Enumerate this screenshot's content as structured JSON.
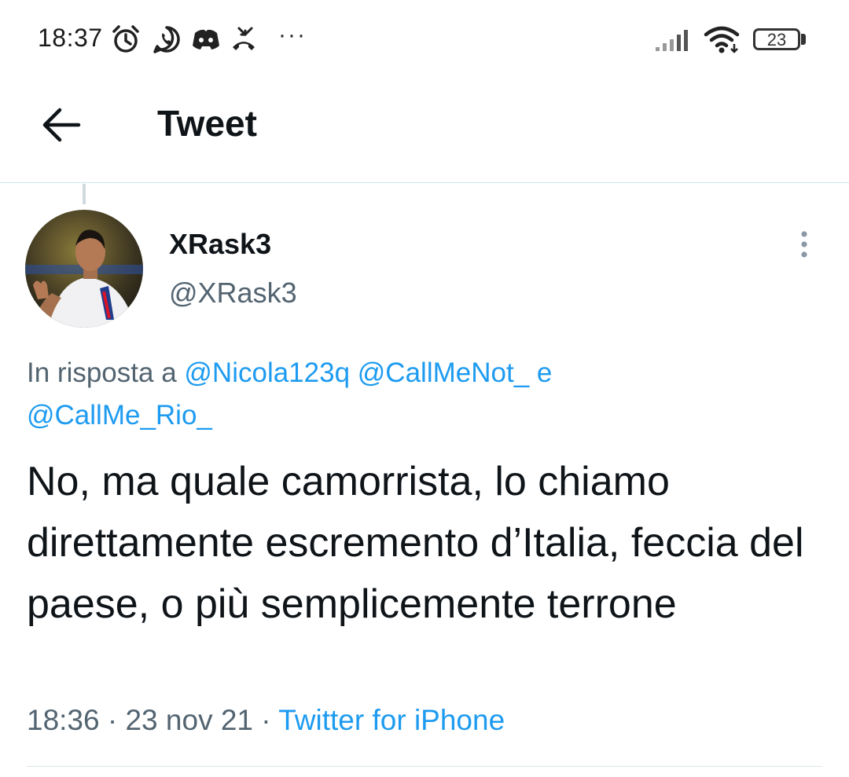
{
  "status_bar": {
    "time": "18:37",
    "icons": [
      "alarm-icon",
      "whatsapp-icon",
      "discord-icon",
      "missed-call-icon",
      "more-notifications-icon",
      "signal-icon",
      "wifi-icon"
    ],
    "more": "···",
    "battery": "23"
  },
  "header": {
    "title": "Tweet",
    "back_icon": "arrow-left-icon"
  },
  "tweet": {
    "display_name": "XRask3",
    "handle": "@XRask3",
    "reply_prefix": "In risposta a",
    "reply_mention_1": "@Nicola123q",
    "reply_mention_2": "@CallMeNot_",
    "reply_conjunction": "e",
    "reply_mention_3": "@CallMe_Rio_",
    "text": "No, ma quale camorrista, lo chiamo direttamente escremento d’Italia, feccia del paese, o più semplicemente terrone",
    "time": "18:36",
    "separator": "·",
    "date": "23 nov 21",
    "source": "Twitter for iPhone",
    "more_icon": "more-vertical-icon"
  },
  "colors": {
    "accent": "#1d9bf0",
    "secondary_text": "#536471",
    "primary_text": "#0f1419"
  }
}
